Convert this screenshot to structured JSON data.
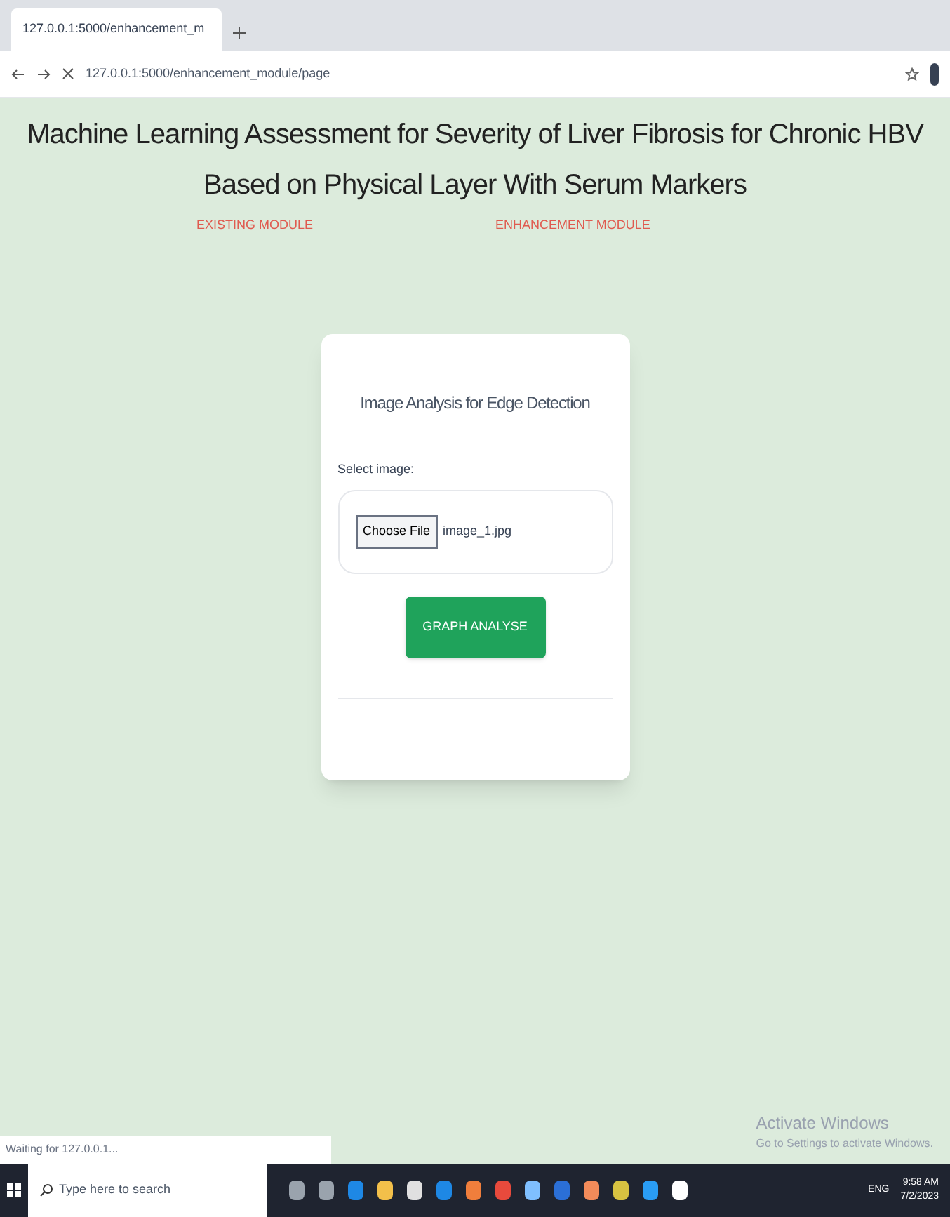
{
  "browser": {
    "tab_title": "127.0.0.1:5000/enhancement_m",
    "url": "127.0.0.1:5000/enhancement_module/page"
  },
  "page": {
    "title": "Machine Learning Assessment for Severity of Liver Fibrosis for Chronic HBV Based on Physical Layer With Serum Markers",
    "nav": [
      {
        "label": "EXISTING MODULE"
      },
      {
        "label": "ENHANCEMENT MODULE"
      }
    ],
    "card": {
      "heading": "Image Analysis for Edge Detection",
      "field_label": "Select image:",
      "file_button": "Choose File",
      "file_name": "image_1.jpg",
      "submit": "GRAPH ANALYSE"
    }
  },
  "watermark": {
    "title": "Activate Windows",
    "subtitle": "Go to Settings to activate Windows."
  },
  "status_text": "Waiting for 127.0.0.1...",
  "taskbar": {
    "search_placeholder": "Type here to search",
    "language": "ENG",
    "time": "9:58 AM",
    "date": "7/2/2023"
  }
}
